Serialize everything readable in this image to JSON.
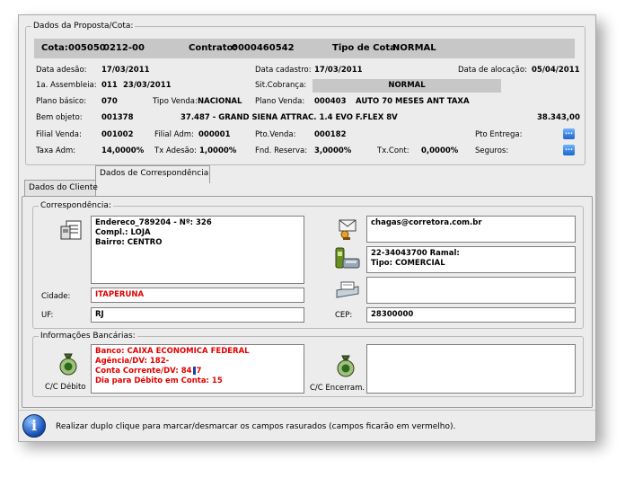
{
  "proposta": {
    "legend": "Dados da Proposta/Cota:",
    "cota_label": "Cota:",
    "cota_value": "005050",
    "cota_suffix": "0212-00",
    "contrato_label": "Contrato:",
    "contrato_value": "0000460542",
    "tipo_label": "Tipo de Cota:",
    "tipo_value": "NORMAL",
    "data_adesao_label": "Data adesão:",
    "data_adesao": "17/03/2011",
    "data_cadastro_label": "Data cadastro:",
    "data_cadastro": "17/03/2011",
    "data_alocacao_label": "Data de alocação:",
    "data_alocacao": "05/04/2011",
    "assembleia_label": "1a. Assembleia:",
    "assembleia_num": "011",
    "assembleia_data": "23/03/2011",
    "sit_cobranca_label": "Sit.Cobrança:",
    "sit_cobranca": "NORMAL",
    "plano_basico_label": "Plano básico:",
    "plano_basico": "070",
    "tipo_venda_label": "Tipo Venda:",
    "tipo_venda": "NACIONAL",
    "plano_venda_label": "Plano Venda:",
    "plano_venda_code": "000403",
    "plano_venda_desc": "AUTO 70 MESES ANT TAXA",
    "bem_objeto_label": "Bem objeto:",
    "bem_objeto_code": "001378",
    "bem_objeto_desc": "37.487 - GRAND SIENA ATTRAC. 1.4 EVO F.FLEX 8V",
    "bem_objeto_valor": "38.343,00",
    "filial_venda_label": "Filial Venda:",
    "filial_venda": "001002",
    "filial_adm_label": "Filial Adm:",
    "filial_adm": "000001",
    "pto_venda_label": "Pto.Venda:",
    "pto_venda": "000182",
    "pto_entrega_label": "Pto Entrega:",
    "taxa_adm_label": "Taxa Adm:",
    "taxa_adm": "14,0000%",
    "tx_adesao_label": "Tx Adesão:",
    "tx_adesao": "1,0000%",
    "fnd_reserva_label": "Fnd. Reserva:",
    "fnd_reserva": "3,0000%",
    "tx_cont_label": "Tx.Cont:",
    "tx_cont": "0,0000%",
    "seguros_label": "Seguros:",
    "dots_button": "..."
  },
  "tabs": [
    {
      "label": "Dados do Cliente"
    },
    {
      "label": "Dados de Correspondência"
    }
  ],
  "correspondencia": {
    "legend": "Correspondência:",
    "endereco_line1": "Endereco_789204 - Nº: 326",
    "endereco_line2": "Compl.: LOJA",
    "endereco_line3": "Bairro: CENTRO",
    "email": "chagas@corretora.com.br",
    "telefone_line1": "22-34043700    Ramal:",
    "telefone_line2": "Tipo: COMERCIAL",
    "fax": "",
    "cidade_label": "Cidade:",
    "cidade": "ITAPERUNA",
    "uf_label": "UF:",
    "uf": "RJ",
    "cep_label": "CEP:",
    "cep": "28300000"
  },
  "bancarias": {
    "legend": "Informações Bancárias:",
    "banco": "Banco: CAIXA ECONOMICA FEDERAL",
    "agencia": "Agência/DV: 182-",
    "conta": "Conta Corrente/DV: 84",
    "conta_tail": "7",
    "dia_debito": "Dia para Débito em Conta: 15",
    "cc_debito_label": "C/C Débito",
    "cc_encerram_label": "C/C Encerram.",
    "cc_encerram_value": ""
  },
  "footer": {
    "info_text": "Realizar duplo clique para marcar/desmarcar os campos rasurados (campos ficarão em vermelho)."
  }
}
